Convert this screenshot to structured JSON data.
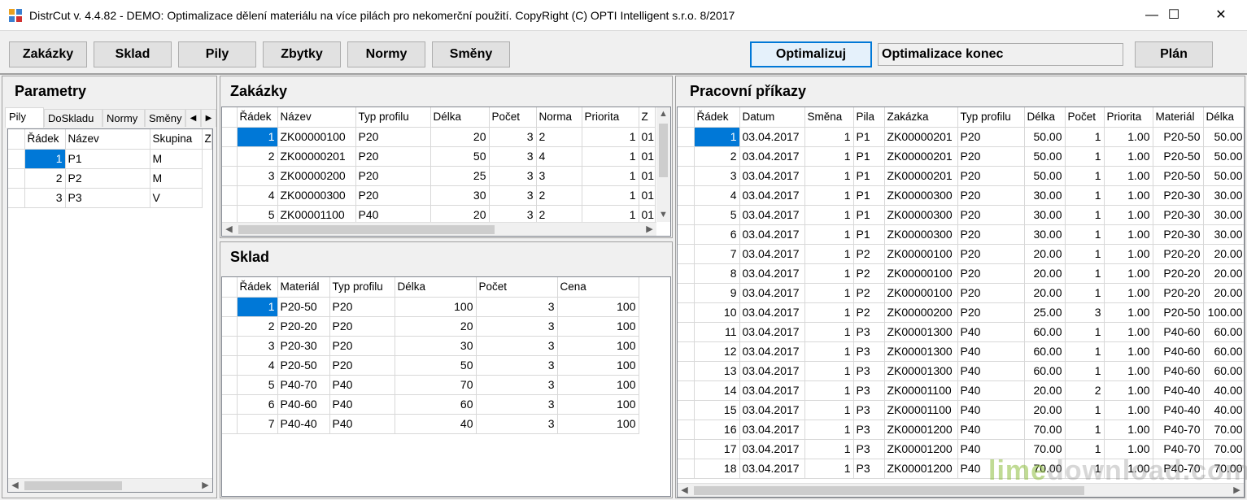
{
  "window": {
    "title": "DistrCut v. 4.4.82 - DEMO: Optimalizace dělení materiálu na více pilách pro nekomerční použití. CopyRight (C) OPTI Intelligent s.r.o. 8/2017",
    "minimize": "—",
    "maximize": "☐",
    "close": "✕"
  },
  "toolbar": {
    "zakazky": "Zakázky",
    "sklad": "Sklad",
    "pily": "Pily",
    "zbytky": "Zbytky",
    "normy": "Normy",
    "smeny": "Směny",
    "optimalizuj": "Optimalizuj",
    "status": "Optimalizace konec",
    "plan": "Plán"
  },
  "parametry": {
    "title": "Parametry",
    "tabs": [
      "Pily",
      "DoSkladu",
      "Normy",
      "Směny"
    ],
    "columns": [
      "Řádek",
      "Název",
      "Skupina",
      "Z"
    ],
    "rows": [
      [
        "1",
        "P1",
        "M"
      ],
      [
        "2",
        "P2",
        "M"
      ],
      [
        "3",
        "P3",
        "V"
      ]
    ]
  },
  "zakazky": {
    "title": "Zakázky",
    "columns": [
      "Řádek",
      "Název",
      "Typ profilu",
      "Délka",
      "Počet",
      "Norma",
      "Priorita",
      "Z"
    ],
    "rows": [
      [
        "1",
        "ZK00000100",
        "P20",
        "20",
        "3",
        "2",
        "1",
        "01"
      ],
      [
        "2",
        "ZK00000201",
        "P20",
        "50",
        "3",
        "4",
        "1",
        "01"
      ],
      [
        "3",
        "ZK00000200",
        "P20",
        "25",
        "3",
        "3",
        "1",
        "01"
      ],
      [
        "4",
        "ZK00000300",
        "P20",
        "30",
        "3",
        "2",
        "1",
        "01"
      ],
      [
        "5",
        "ZK00001100",
        "P40",
        "20",
        "3",
        "2",
        "1",
        "01"
      ]
    ]
  },
  "sklad": {
    "title": "Sklad",
    "columns": [
      "Řádek",
      "Materiál",
      "Typ profilu",
      "Délka",
      "Počet",
      "Cena"
    ],
    "rows": [
      [
        "1",
        "P20-50",
        "P20",
        "100",
        "3",
        "100"
      ],
      [
        "2",
        "P20-20",
        "P20",
        "20",
        "3",
        "100"
      ],
      [
        "3",
        "P20-30",
        "P20",
        "30",
        "3",
        "100"
      ],
      [
        "4",
        "P20-50",
        "P20",
        "50",
        "3",
        "100"
      ],
      [
        "5",
        "P40-70",
        "P40",
        "70",
        "3",
        "100"
      ],
      [
        "6",
        "P40-60",
        "P40",
        "60",
        "3",
        "100"
      ],
      [
        "7",
        "P40-40",
        "P40",
        "40",
        "3",
        "100"
      ]
    ]
  },
  "prikazy": {
    "title": "Pracovní příkazy",
    "columns": [
      "Řádek",
      "Datum",
      "Směna",
      "Pila",
      "Zakázka",
      "Typ profilu",
      "Délka",
      "Počet",
      "Priorita",
      "Materiál",
      "Délka"
    ],
    "rows": [
      [
        "1",
        "03.04.2017",
        "1",
        "P1",
        "ZK00000201",
        "P20",
        "50.00",
        "1",
        "1.00",
        "P20-50",
        "50.00"
      ],
      [
        "2",
        "03.04.2017",
        "1",
        "P1",
        "ZK00000201",
        "P20",
        "50.00",
        "1",
        "1.00",
        "P20-50",
        "50.00"
      ],
      [
        "3",
        "03.04.2017",
        "1",
        "P1",
        "ZK00000201",
        "P20",
        "50.00",
        "1",
        "1.00",
        "P20-50",
        "50.00"
      ],
      [
        "4",
        "03.04.2017",
        "1",
        "P1",
        "ZK00000300",
        "P20",
        "30.00",
        "1",
        "1.00",
        "P20-30",
        "30.00"
      ],
      [
        "5",
        "03.04.2017",
        "1",
        "P1",
        "ZK00000300",
        "P20",
        "30.00",
        "1",
        "1.00",
        "P20-30",
        "30.00"
      ],
      [
        "6",
        "03.04.2017",
        "1",
        "P1",
        "ZK00000300",
        "P20",
        "30.00",
        "1",
        "1.00",
        "P20-30",
        "30.00"
      ],
      [
        "7",
        "03.04.2017",
        "1",
        "P2",
        "ZK00000100",
        "P20",
        "20.00",
        "1",
        "1.00",
        "P20-20",
        "20.00"
      ],
      [
        "8",
        "03.04.2017",
        "1",
        "P2",
        "ZK00000100",
        "P20",
        "20.00",
        "1",
        "1.00",
        "P20-20",
        "20.00"
      ],
      [
        "9",
        "03.04.2017",
        "1",
        "P2",
        "ZK00000100",
        "P20",
        "20.00",
        "1",
        "1.00",
        "P20-20",
        "20.00"
      ],
      [
        "10",
        "03.04.2017",
        "1",
        "P2",
        "ZK00000200",
        "P20",
        "25.00",
        "3",
        "1.00",
        "P20-50",
        "100.00"
      ],
      [
        "11",
        "03.04.2017",
        "1",
        "P3",
        "ZK00001300",
        "P40",
        "60.00",
        "1",
        "1.00",
        "P40-60",
        "60.00"
      ],
      [
        "12",
        "03.04.2017",
        "1",
        "P3",
        "ZK00001300",
        "P40",
        "60.00",
        "1",
        "1.00",
        "P40-60",
        "60.00"
      ],
      [
        "13",
        "03.04.2017",
        "1",
        "P3",
        "ZK00001300",
        "P40",
        "60.00",
        "1",
        "1.00",
        "P40-60",
        "60.00"
      ],
      [
        "14",
        "03.04.2017",
        "1",
        "P3",
        "ZK00001100",
        "P40",
        "20.00",
        "2",
        "1.00",
        "P40-40",
        "40.00"
      ],
      [
        "15",
        "03.04.2017",
        "1",
        "P3",
        "ZK00001100",
        "P40",
        "20.00",
        "1",
        "1.00",
        "P40-40",
        "40.00"
      ],
      [
        "16",
        "03.04.2017",
        "1",
        "P3",
        "ZK00001200",
        "P40",
        "70.00",
        "1",
        "1.00",
        "P40-70",
        "70.00"
      ],
      [
        "17",
        "03.04.2017",
        "1",
        "P3",
        "ZK00001200",
        "P40",
        "70.00",
        "1",
        "1.00",
        "P40-70",
        "70.00"
      ],
      [
        "18",
        "03.04.2017",
        "1",
        "P3",
        "ZK00001200",
        "P40",
        "70.00",
        "1",
        "1.00",
        "P40-70",
        "70.00"
      ]
    ]
  },
  "watermark": {
    "a": "lime",
    "b": "download.com"
  }
}
